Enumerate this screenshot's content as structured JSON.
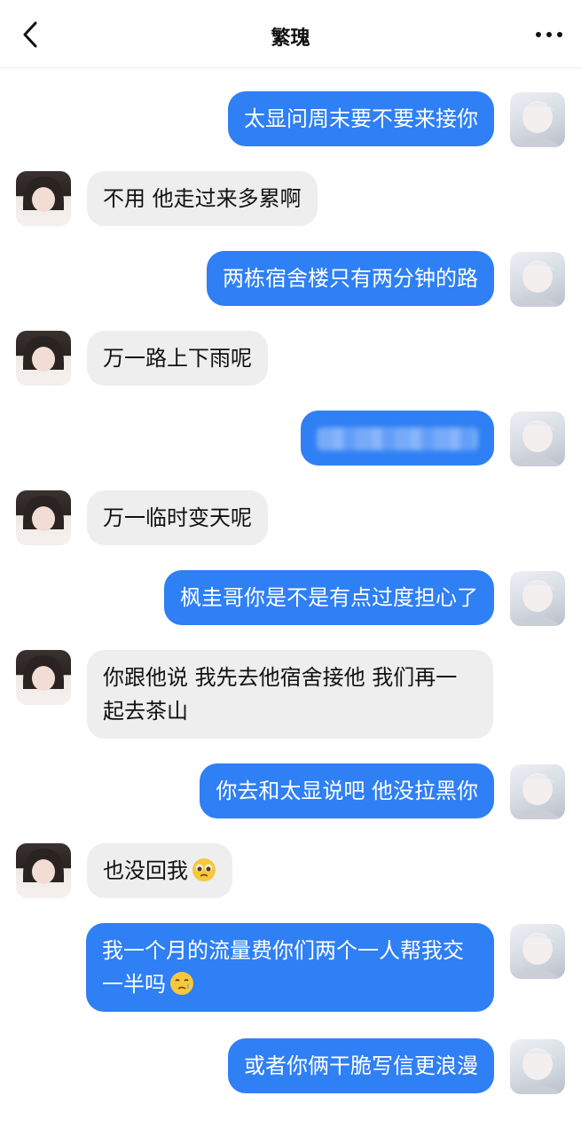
{
  "header": {
    "title": "繁瑰",
    "back_icon": "chevron-left-icon",
    "more_icon": "more-horizontal-icon"
  },
  "messages": [
    {
      "from": "me",
      "text": "太显问周末要不要来接你"
    },
    {
      "from": "her",
      "text": "不用 他走过来多累啊"
    },
    {
      "from": "me",
      "text": "两栋宿舍楼只有两分钟的路"
    },
    {
      "from": "her",
      "text": "万一路上下雨呢"
    },
    {
      "from": "me",
      "text": "",
      "blurred": true
    },
    {
      "from": "her",
      "text": "万一临时变天呢"
    },
    {
      "from": "me",
      "text": "枫圭哥你是不是有点过度担心了"
    },
    {
      "from": "her",
      "text": "你跟他说 我先去他宿舍接他 我们再一起去茶山"
    },
    {
      "from": "me",
      "text": "你去和太显说吧 他没拉黑你"
    },
    {
      "from": "her",
      "text": "也没回我",
      "emoji": "pleading-face-emoji"
    },
    {
      "from": "me",
      "text": "我一个月的流量费你们两个一人帮我交一半吗",
      "emoji": "crying-face-emoji"
    },
    {
      "from": "me",
      "text": "或者你俩干脆写信更浪漫"
    }
  ],
  "colors": {
    "my_bubble": "#2f7ff5",
    "her_bubble": "#eeeeef"
  }
}
